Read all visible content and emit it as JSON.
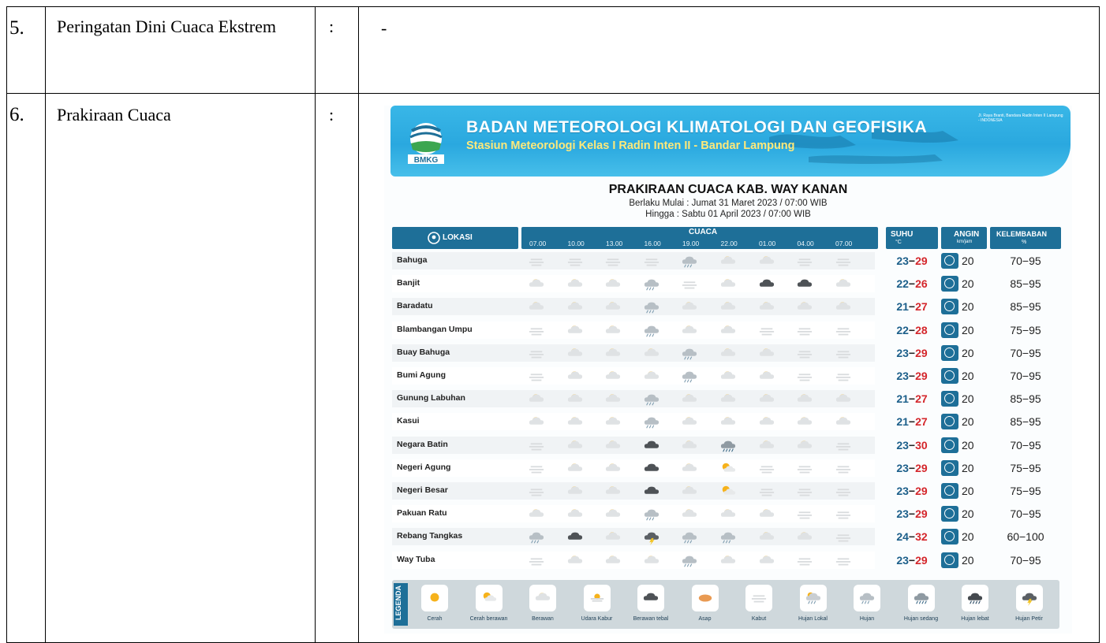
{
  "document": {
    "rows": [
      {
        "no": "5.",
        "label": "Peringatan Dini Cuaca Ekstrem",
        "sep": ":",
        "value": "-"
      },
      {
        "no": "6.",
        "label": "Prakiraan Cuaca",
        "sep": ":",
        "value": ""
      }
    ]
  },
  "forecast": {
    "agency": "BADAN METEOROLOGI KLIMATOLOGI DAN GEOFISIKA",
    "station": "Stasiun Meteorologi Kelas I Radin Inten II - Bandar Lampung",
    "logo_text": "BMKG",
    "address": "Jl. Raya Branti, Bandara Radin Inten II Lampung - INDONESIA",
    "title": "PRAKIRAAN CUACA KAB. WAY KANAN",
    "valid_from": "Berlaku Mulai : Jumat 31 Maret 2023 / 07:00 WIB",
    "valid_to": "Hingga : Sabtu 01 April 2023 / 07:00 WIB",
    "headers": {
      "lokasi": "LOKASI",
      "cuaca": "CUACA",
      "suhu": "SUHU",
      "suhu_unit": "°C",
      "angin": "ANGIN",
      "angin_unit": "km/jam",
      "kelembaban": "KELEMBABAN",
      "kelembaban_unit": "%"
    },
    "hours": [
      "07.00",
      "10.00",
      "13.00",
      "16.00",
      "19.00",
      "22.00",
      "01.00",
      "04.00",
      "07.00"
    ],
    "colors": {
      "primary": "#1e6f98",
      "banner": "#2aa8df",
      "min_temp": "#1c5f8a",
      "max_temp": "#d4262b",
      "accent_yellow": "#ffe97a"
    },
    "rows": [
      {
        "loc": "Bahuga",
        "wx": [
          "kabut",
          "kabut",
          "kabut",
          "kabut",
          "hujan",
          "berawan",
          "berawan",
          "kabut",
          "kabut"
        ],
        "tmin": "23",
        "tmax": "29",
        "wind": "20",
        "hum": "70−95"
      },
      {
        "loc": "Banjit",
        "wx": [
          "berawan",
          "berawan",
          "berawan",
          "hujan",
          "kabut",
          "berawan",
          "tebal",
          "tebal",
          "berawan"
        ],
        "tmin": "22",
        "tmax": "26",
        "wind": "20",
        "hum": "85−95"
      },
      {
        "loc": "Baradatu",
        "wx": [
          "berawan",
          "berawan",
          "berawan",
          "hujan",
          "berawan",
          "berawan",
          "berawan",
          "berawan",
          "berawan"
        ],
        "tmin": "21",
        "tmax": "27",
        "wind": "20",
        "hum": "85−95"
      },
      {
        "loc": "Blambangan Umpu",
        "wx": [
          "kabut",
          "berawan",
          "berawan",
          "hujan",
          "berawan",
          "berawan",
          "kabut",
          "kabut",
          "kabut"
        ],
        "tmin": "22",
        "tmax": "28",
        "wind": "20",
        "hum": "75−95"
      },
      {
        "loc": "Buay Bahuga",
        "wx": [
          "kabut",
          "berawan",
          "berawan",
          "berawan",
          "hujan",
          "berawan",
          "berawan",
          "kabut",
          "kabut"
        ],
        "tmin": "23",
        "tmax": "29",
        "wind": "20",
        "hum": "70−95"
      },
      {
        "loc": "Bumi Agung",
        "wx": [
          "kabut",
          "berawan",
          "berawan",
          "berawan",
          "hujan",
          "berawan",
          "berawan",
          "kabut",
          "kabut"
        ],
        "tmin": "23",
        "tmax": "29",
        "wind": "20",
        "hum": "70−95"
      },
      {
        "loc": "Gunung Labuhan",
        "wx": [
          "berawan",
          "berawan",
          "berawan",
          "hujan",
          "berawan",
          "berawan",
          "berawan",
          "berawan",
          "berawan"
        ],
        "tmin": "21",
        "tmax": "27",
        "wind": "20",
        "hum": "85−95"
      },
      {
        "loc": "Kasui",
        "wx": [
          "berawan",
          "berawan",
          "berawan",
          "hujan",
          "berawan",
          "berawan",
          "berawan",
          "berawan",
          "berawan"
        ],
        "tmin": "21",
        "tmax": "27",
        "wind": "20",
        "hum": "85−95"
      },
      {
        "loc": "Negara Batin",
        "wx": [
          "kabut",
          "berawan",
          "berawan",
          "tebal",
          "berawan",
          "sedang",
          "berawan",
          "berawan",
          "kabut"
        ],
        "tmin": "23",
        "tmax": "30",
        "wind": "20",
        "hum": "70−95"
      },
      {
        "loc": "Negeri Agung",
        "wx": [
          "kabut",
          "berawan",
          "berawan",
          "tebal",
          "berawan",
          "cerahberawan",
          "kabut",
          "kabut",
          "kabut"
        ],
        "tmin": "23",
        "tmax": "29",
        "wind": "20",
        "hum": "75−95"
      },
      {
        "loc": "Negeri Besar",
        "wx": [
          "kabut",
          "berawan",
          "berawan",
          "tebal",
          "berawan",
          "cerahberawan",
          "kabut",
          "kabut",
          "kabut"
        ],
        "tmin": "23",
        "tmax": "29",
        "wind": "20",
        "hum": "75−95"
      },
      {
        "loc": "Pakuan Ratu",
        "wx": [
          "berawan",
          "berawan",
          "berawan",
          "hujan",
          "berawan",
          "berawan",
          "berawan",
          "kabut",
          "kabut"
        ],
        "tmin": "23",
        "tmax": "29",
        "wind": "20",
        "hum": "70−95"
      },
      {
        "loc": "Rebang Tangkas",
        "wx": [
          "hujan",
          "tebal",
          "berawan",
          "petir",
          "hujan",
          "hujan",
          "berawan",
          "berawan",
          "kabut"
        ],
        "tmin": "24",
        "tmax": "32",
        "wind": "20",
        "hum": "60−100"
      },
      {
        "loc": "Way Tuba",
        "wx": [
          "kabut",
          "berawan",
          "berawan",
          "berawan",
          "hujan",
          "berawan",
          "berawan",
          "kabut",
          "kabut"
        ],
        "tmin": "23",
        "tmax": "29",
        "wind": "20",
        "hum": "70−95"
      }
    ],
    "legend_title": "LEGENDA",
    "legend": [
      {
        "type": "cerah",
        "label": "Cerah"
      },
      {
        "type": "cerahberawan",
        "label": "Cerah berawan"
      },
      {
        "type": "berawan",
        "label": "Berawan"
      },
      {
        "type": "udara",
        "label": "Udara Kabur"
      },
      {
        "type": "tebal",
        "label": "Berawan tebal"
      },
      {
        "type": "asap",
        "label": "Asap"
      },
      {
        "type": "kabut",
        "label": "Kabut"
      },
      {
        "type": "lokal",
        "label": "Hujan Lokal"
      },
      {
        "type": "hujan",
        "label": "Hujan"
      },
      {
        "type": "sedang",
        "label": "Hujan sedang"
      },
      {
        "type": "lebat",
        "label": "Hujan lebat"
      },
      {
        "type": "petir",
        "label": "Hujan Petir"
      }
    ]
  }
}
